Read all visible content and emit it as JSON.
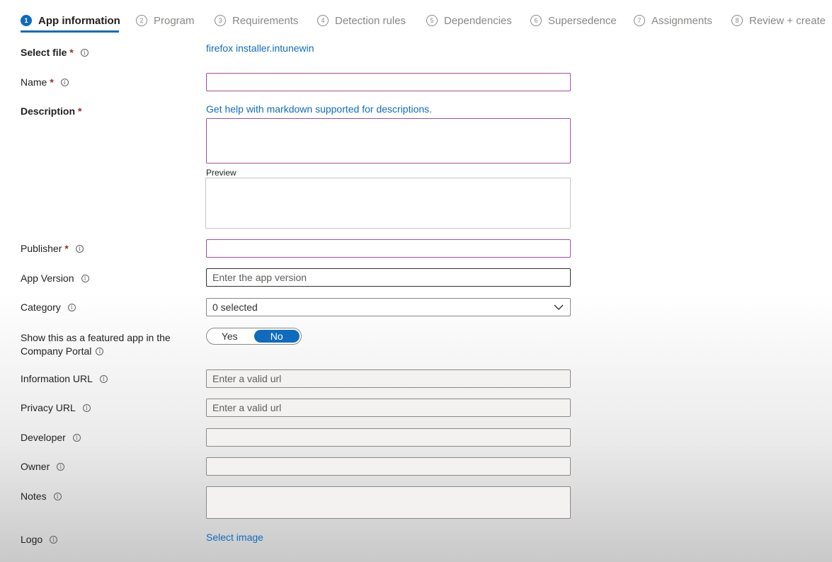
{
  "steps": [
    {
      "num": "1",
      "label": "App information"
    },
    {
      "num": "2",
      "label": "Program"
    },
    {
      "num": "3",
      "label": "Requirements"
    },
    {
      "num": "4",
      "label": "Detection rules"
    },
    {
      "num": "5",
      "label": "Dependencies"
    },
    {
      "num": "6",
      "label": "Supersedence"
    },
    {
      "num": "7",
      "label": "Assignments"
    },
    {
      "num": "8",
      "label": "Review + create"
    }
  ],
  "form": {
    "select_file": {
      "label": "Select file",
      "value": "firefox installer.intunewin"
    },
    "name": {
      "label": "Name",
      "value": ""
    },
    "description": {
      "label": "Description",
      "help_link": "Get help with markdown supported for descriptions.",
      "value": "",
      "preview_label": "Preview"
    },
    "publisher": {
      "label": "Publisher",
      "value": ""
    },
    "app_version": {
      "label": "App Version",
      "placeholder": "Enter the app version"
    },
    "category": {
      "label": "Category",
      "value": "0 selected"
    },
    "featured": {
      "label_line1": "Show this as a featured app in the",
      "label_line2": "Company Portal",
      "yes": "Yes",
      "no": "No",
      "selected": "No"
    },
    "information_url": {
      "label": "Information URL",
      "placeholder": "Enter a valid url"
    },
    "privacy_url": {
      "label": "Privacy URL",
      "placeholder": "Enter a valid url"
    },
    "developer": {
      "label": "Developer",
      "value": ""
    },
    "owner": {
      "label": "Owner",
      "value": ""
    },
    "notes": {
      "label": "Notes",
      "value": ""
    },
    "logo": {
      "label": "Logo",
      "link": "Select image"
    }
  },
  "required_mark": "*",
  "info_glyph": "i",
  "icons": {
    "info": "info-circle-icon",
    "chevron": "chevron-down-icon"
  },
  "colors": {
    "accent": "#0f6cbd",
    "required": "#a4262c",
    "required_border": "#a44ea1"
  }
}
